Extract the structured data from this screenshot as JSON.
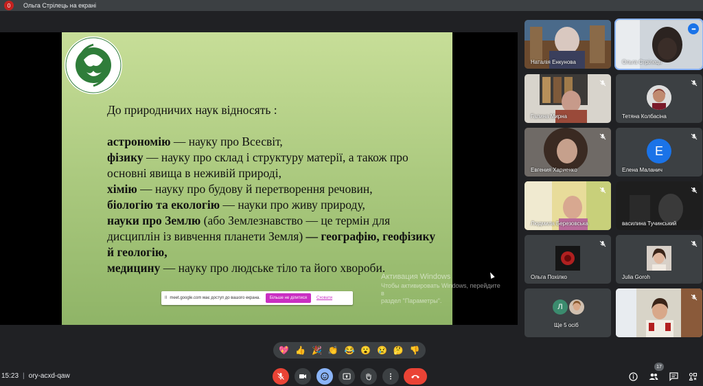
{
  "topbar": {
    "avatar_letter": "0",
    "title": "Ольга Стрілець на екрані"
  },
  "slide": {
    "logo_text_top": "Донецький обласний еколого-натуралістичний центр",
    "logo_text_bottom": "м.Краматорськ",
    "heading": "До природничих наук відносять :",
    "lines": [
      {
        "bold": "астрономію",
        "text": " — науку про Всесвіт,"
      },
      {
        "bold": "фізику",
        "text": " — науку про склад і структуру матерії, а також про основні явища в неживій природі,"
      },
      {
        "bold": "хімію",
        "text": " — науку про будову й перетворення речовин,"
      },
      {
        "bold": "біологію та екологію",
        "text": "  — науки про живу природу,"
      },
      {
        "bold": "науки про Землю",
        "text": " (або Землезнавство — це термін для дисциплін із вивчення планети Земля) ",
        "bold2": "— географію, геофізику й геологію,"
      },
      {
        "bold": "медицину",
        "text": " — науку про людське тіло та його хвороби."
      }
    ]
  },
  "share_bar": {
    "pause": "II",
    "message": "meet.google.com має доступ до вашого екрана.",
    "stop_label": "Більше не ділитися",
    "hide_label": "Сховати"
  },
  "windows_activation": {
    "title": "Активация Windows",
    "line1": "Чтобы активировать Windows, перейдите в",
    "line2": "раздел \"Параметры\"."
  },
  "participants": [
    {
      "name": "Наталія Енкунова",
      "type": "video",
      "muted": false
    },
    {
      "name": "Ольга Стрілець",
      "type": "video",
      "muted": false,
      "active": true
    },
    {
      "name": "Галина Мирна",
      "type": "video",
      "muted": true
    },
    {
      "name": "Тетяна Колбасіна",
      "type": "video",
      "muted": true
    },
    {
      "name": "Евгения Хариенко",
      "type": "video",
      "muted": true
    },
    {
      "name": "Елена Маланич",
      "type": "avatar",
      "letter": "E",
      "color": "#1a73e8",
      "muted": true
    },
    {
      "name": "Людмила Березовська",
      "type": "video",
      "muted": true
    },
    {
      "name": "василина Тучинський",
      "type": "video",
      "muted": true
    },
    {
      "name": "Ольга Похілко",
      "type": "photo-avatar",
      "muted": true
    },
    {
      "name": "Julia Goroh",
      "type": "photo-avatar",
      "muted": true
    },
    {
      "name": "Ще 5 осіб",
      "type": "group",
      "letter": "Л",
      "color": "#3b8b6e"
    },
    {
      "name": "",
      "type": "video",
      "muted": true
    }
  ],
  "reactions": [
    "💖",
    "👍",
    "🎉",
    "👏",
    "😂",
    "😮",
    "😢",
    "🤔",
    "👎"
  ],
  "bottombar": {
    "time": "15:23",
    "separator": "|",
    "meeting_code": "ory-acxd-qaw",
    "people_count": "17"
  },
  "colors": {
    "background": "#202124",
    "end_call": "#ea4335",
    "accent": "#8ab4f8",
    "stop_share": "#c92fc2"
  }
}
